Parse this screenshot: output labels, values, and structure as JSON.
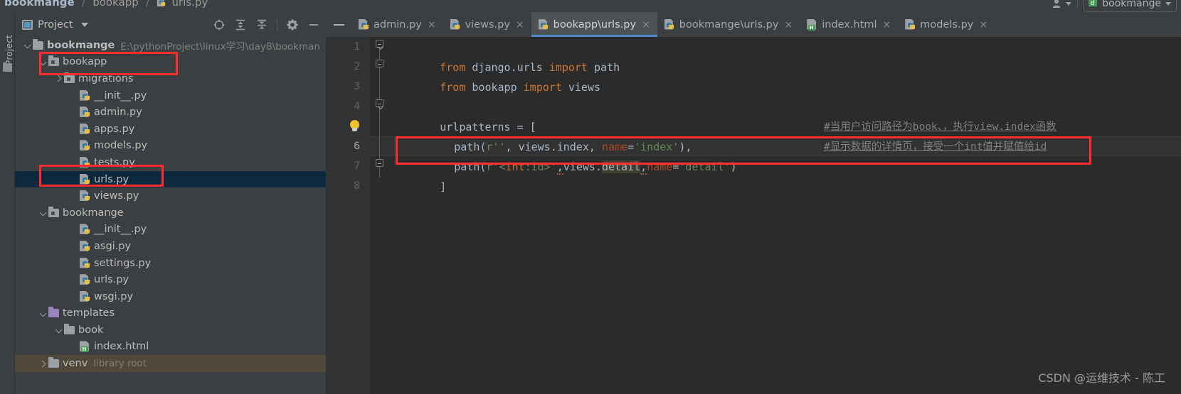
{
  "breadcrumb": {
    "items": [
      "bookmange",
      "bookapp",
      "urls.py"
    ],
    "separator": "/"
  },
  "topright": {
    "profile_icon": "user-icon",
    "run_config": "bookmange",
    "run_config_icon": "django-icon"
  },
  "tool_strip": {
    "label": "Project",
    "icon": "folder-icon"
  },
  "project_panel": {
    "title": "Project",
    "title_icon": "project-icon",
    "dropdown_icon": "chevron-down-icon",
    "tools": [
      {
        "name": "locate-icon",
        "title": "Select Opened File"
      },
      {
        "name": "expand-all-icon",
        "title": "Expand All"
      },
      {
        "name": "collapse-all-icon",
        "title": "Collapse All"
      },
      {
        "name": "gear-icon",
        "title": "Settings"
      },
      {
        "name": "minimize-icon",
        "title": "Hide"
      }
    ]
  },
  "tree": [
    {
      "label": "bookmange",
      "path": "E:\\pythonProject\\linux学习\\day8\\bookman",
      "indent": 0,
      "icon": "folder",
      "twisty": "down",
      "bold": true
    },
    {
      "label": "bookapp",
      "indent": 1,
      "icon": "folder-module",
      "twisty": "down",
      "highlight": true
    },
    {
      "label": "migrations",
      "indent": 2,
      "icon": "folder-module",
      "twisty": "right"
    },
    {
      "label": "__init__.py",
      "indent": 3,
      "icon": "python"
    },
    {
      "label": "admin.py",
      "indent": 3,
      "icon": "python"
    },
    {
      "label": "apps.py",
      "indent": 3,
      "icon": "python"
    },
    {
      "label": "models.py",
      "indent": 3,
      "icon": "python"
    },
    {
      "label": "tests.py",
      "indent": 3,
      "icon": "python"
    },
    {
      "label": "urls.py",
      "indent": 3,
      "icon": "python",
      "selected": true,
      "highlight": true
    },
    {
      "label": "views.py",
      "indent": 3,
      "icon": "python"
    },
    {
      "label": "bookmange",
      "indent": 1,
      "icon": "folder-module",
      "twisty": "down"
    },
    {
      "label": "__init__.py",
      "indent": 3,
      "icon": "python"
    },
    {
      "label": "asgi.py",
      "indent": 3,
      "icon": "python"
    },
    {
      "label": "settings.py",
      "indent": 3,
      "icon": "python"
    },
    {
      "label": "urls.py",
      "indent": 3,
      "icon": "python"
    },
    {
      "label": "wsgi.py",
      "indent": 3,
      "icon": "python"
    },
    {
      "label": "templates",
      "indent": 1,
      "icon": "folder-purple",
      "twisty": "down"
    },
    {
      "label": "book",
      "indent": 2,
      "icon": "folder",
      "twisty": "down"
    },
    {
      "label": "index.html",
      "indent": 3,
      "icon": "html"
    },
    {
      "label": "venv",
      "indent": 1,
      "icon": "folder",
      "twisty": "right",
      "suffix": "library root",
      "venv": true
    }
  ],
  "tabs": [
    {
      "label": "admin.py",
      "icon": "python",
      "active": false,
      "close": "×"
    },
    {
      "label": "views.py",
      "icon": "python",
      "active": false,
      "close": "×"
    },
    {
      "label": "bookapp\\urls.py",
      "icon": "python",
      "active": true,
      "close": "×"
    },
    {
      "label": "bookmange\\urls.py",
      "icon": "python",
      "active": false,
      "close": "×"
    },
    {
      "label": "index.html",
      "icon": "html",
      "active": false,
      "close": "×"
    },
    {
      "label": "models.py",
      "icon": "python",
      "active": false,
      "close": "×"
    }
  ],
  "editor": {
    "line_numbers": [
      "1",
      "2",
      "3",
      "4",
      "5",
      "6",
      "7",
      "8"
    ],
    "current_line": 6,
    "lines": {
      "l1_kw": "from",
      "l1_mod": " django.urls ",
      "l1_kw2": "import",
      "l1_name": " path",
      "l2_kw": "from",
      "l2_mod": " bookapp ",
      "l2_kw2": "import",
      "l2_name": " views",
      "l4": "urlpatterns = [",
      "l5_call": "path(",
      "l5_r": "r",
      "l5_str": "''",
      "l5_mid": ", views.index, ",
      "l5_name": "name",
      "l5_eq": "=",
      "l5_val": "'index'",
      "l5_end": "),",
      "l6_call": "path(",
      "l6_r": "r",
      "l6_str1": "'<",
      "l6_pat": "int",
      "l6_str2": ":id>'",
      "l6_comma1": ",",
      "l6_views": "views.",
      "l6_detail": "detail",
      "l6_comma2": ",",
      "l6_name": "name",
      "l6_eq": "=",
      "l6_val": "'detail'",
      "l6_end": ")",
      "l7": "]"
    },
    "comments": {
      "line5": "#当用户访问路径为book、，执行view.index函数",
      "line6": "#显示数据的详情页，接受一个int值并赋值给id"
    },
    "intention_icon": "lightbulb-icon"
  },
  "watermark": "CSDN @运维技术 - 陈工",
  "colors": {
    "accent_blue": "#4a88c7",
    "annotation_red": "#ff2d2d",
    "selection_blue": "#0d293e",
    "editor_bg": "#2b2b2b",
    "panel_bg": "#3c3f41"
  }
}
